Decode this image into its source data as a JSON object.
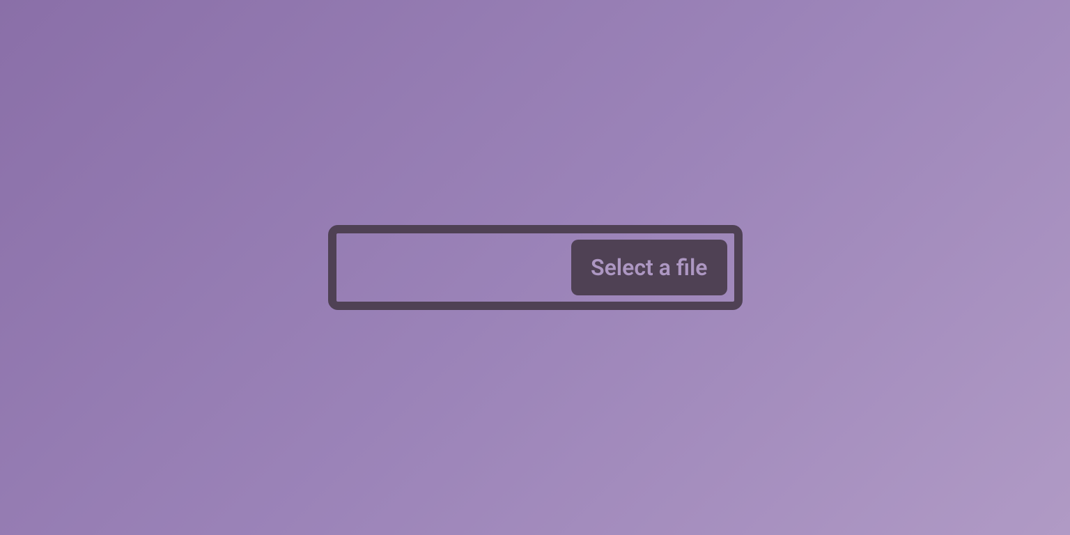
{
  "file_input": {
    "button_label": "Select a file"
  }
}
